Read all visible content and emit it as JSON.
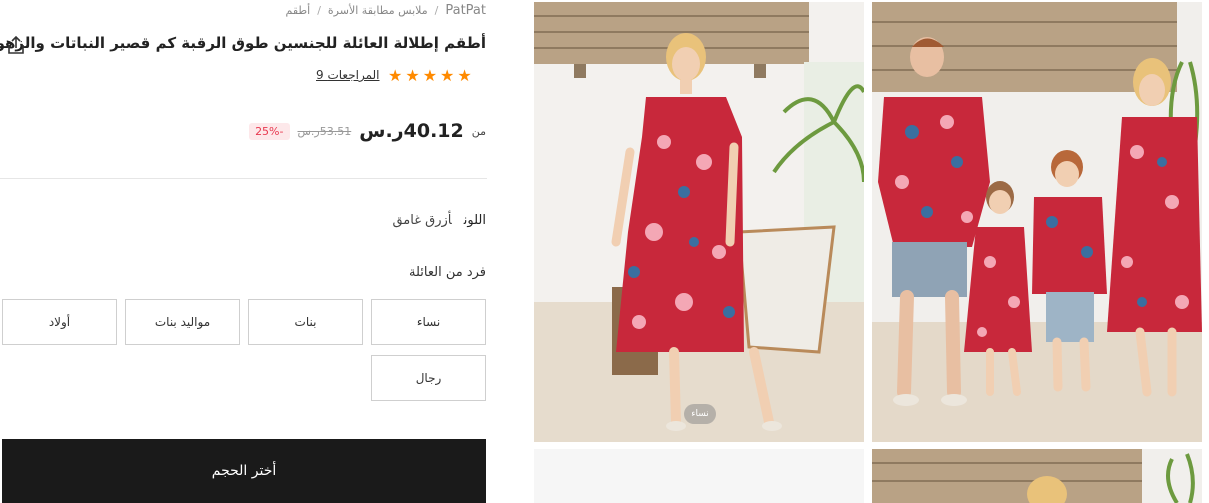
{
  "breadcrumb": {
    "brand": "PatPat",
    "items": [
      "ملابس مطابقة الأسرة",
      "أطقم"
    ]
  },
  "product": {
    "title": "أطقم إطلالة العائلة للجنسين طوق الرقبة كم قصير النباتات والزهور",
    "rating": 5,
    "reviews_label": "9 المراجعات",
    "price_from": "من",
    "price": "40.12ر.س",
    "price_old": "53.51ر.س",
    "discount": "-25%"
  },
  "color": {
    "label": "اللون",
    "value": "أزرق غامق"
  },
  "member": {
    "label": "فرد من العائلة",
    "options": [
      "نساء",
      "بنات",
      "مواليد بنات",
      "أولاد",
      "رجال"
    ]
  },
  "actions": {
    "choose_size": "أختر الحجم"
  },
  "gallery": {
    "tag": "نساء"
  },
  "colors": {
    "star": "#ff8a00",
    "discount": "#e8384f",
    "button_bg": "#1a1a1a"
  }
}
